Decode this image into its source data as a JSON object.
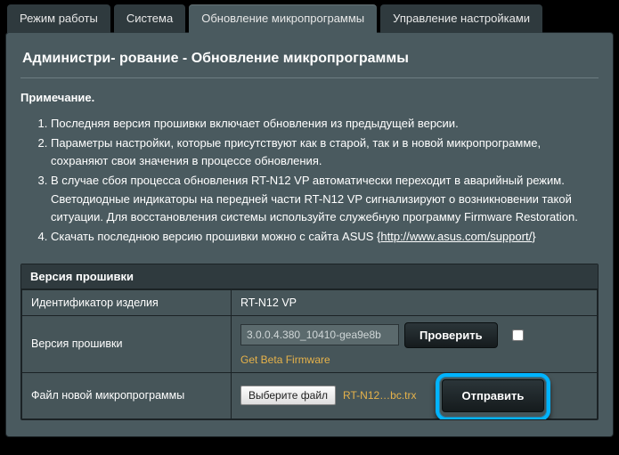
{
  "tabs": {
    "mode": {
      "label": "Режим работы"
    },
    "system": {
      "label": "Система"
    },
    "fw": {
      "label": "Обновление микропрограммы"
    },
    "cfg": {
      "label": "Управление настройками"
    }
  },
  "title": "Администри- рование - Обновление микропрограммы",
  "note_head": "Примечание.",
  "notes": {
    "n1": "Последняя версия прошивки включает обновления из предыдущей версии.",
    "n2": "Параметры настройки, которые присутствуют как в старой, так и в новой микропрограмме, сохраняют свои значения в процессе обновления.",
    "n3": "В случае сбоя процесса обновления RT-N12 VP автоматически переходит в аварийный режим. Светодиодные индикаторы на передней части RT-N12 VP сигнализируют о возникновении такой ситуации. Для восстановления системы используйте служебную программу Firmware Restoration.",
    "n4_pre": "Скачать последнюю версию прошивки можно с сайта ASUS {",
    "n4_link": "http://www.asus.com/support/",
    "n4_post": "}"
  },
  "table": {
    "head": "Версия прошивки",
    "product_label": "Идентификатор изделия",
    "product_value": "RT-N12 VP",
    "fw_label": "Версия прошивки",
    "fw_value": "3.0.0.4.380_10410-gea9e8b",
    "check_btn": "Проверить",
    "beta_label": "Get Beta Firmware",
    "file_label": "Файл новой микропрограммы",
    "choose_btn": "Выберите файл",
    "file_name": "RT-N12…bc.trx",
    "send_btn": "Отправить"
  }
}
